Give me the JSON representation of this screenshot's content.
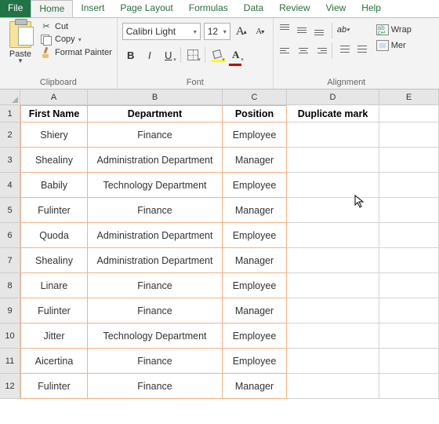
{
  "tabs": {
    "file": "File",
    "home": "Home",
    "insert": "Insert",
    "page_layout": "Page Layout",
    "formulas": "Formulas",
    "data": "Data",
    "review": "Review",
    "view": "View",
    "help": "Help"
  },
  "ribbon": {
    "clipboard": {
      "paste": "Paste",
      "cut": "Cut",
      "copy": "Copy",
      "format_painter": "Format Painter",
      "label": "Clipboard"
    },
    "font": {
      "name": "Calibri Light",
      "size": "12",
      "label": "Font"
    },
    "alignment": {
      "wrap": "Wrap",
      "merge": "Mer",
      "label": "Alignment"
    }
  },
  "sheet": {
    "columns": [
      "A",
      "B",
      "C",
      "D",
      "E"
    ],
    "headers": {
      "a": "First Name",
      "b": "Department",
      "c": "Position",
      "d": "Duplicate mark"
    },
    "rows": [
      {
        "a": "Shiery",
        "b": "Finance",
        "c": "Employee",
        "d": ""
      },
      {
        "a": "Shealiny",
        "b": "Administration Department",
        "c": "Manager",
        "d": ""
      },
      {
        "a": "Babily",
        "b": "Technology Department",
        "c": "Employee",
        "d": ""
      },
      {
        "a": "Fulinter",
        "b": "Finance",
        "c": "Manager",
        "d": ""
      },
      {
        "a": "Quoda",
        "b": "Administration Department",
        "c": "Employee",
        "d": ""
      },
      {
        "a": "Shealiny",
        "b": "Administration Department",
        "c": "Manager",
        "d": ""
      },
      {
        "a": "Linare",
        "b": "Finance",
        "c": "Employee",
        "d": ""
      },
      {
        "a": "Fulinter",
        "b": "Finance",
        "c": "Manager",
        "d": ""
      },
      {
        "a": "Jitter",
        "b": "Technology Department",
        "c": "Employee",
        "d": ""
      },
      {
        "a": "Aicertina",
        "b": "Finance",
        "c": "Employee",
        "d": ""
      },
      {
        "a": "Fulinter",
        "b": "Finance",
        "c": "Manager",
        "d": ""
      }
    ]
  }
}
